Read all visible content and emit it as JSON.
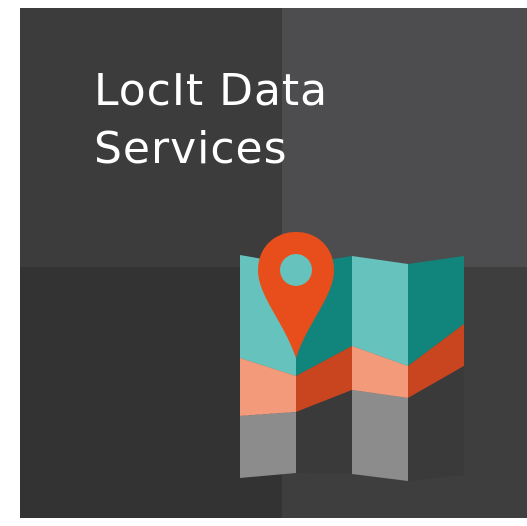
{
  "tile": {
    "title_line1": "LocIt Data",
    "title_line2": "Services"
  },
  "icons": {
    "map": "folded-map-icon",
    "pin": "location-pin-icon"
  },
  "colors": {
    "teal_light": "#66c2bd",
    "teal_dark": "#11847c",
    "road_light": "#f29a7a",
    "road_dark": "#c9451f",
    "pin": "#e84e1b",
    "gray_light": "#8c8c8c",
    "gray_dark": "#3a3a3b",
    "title_text": "#ffffff"
  }
}
